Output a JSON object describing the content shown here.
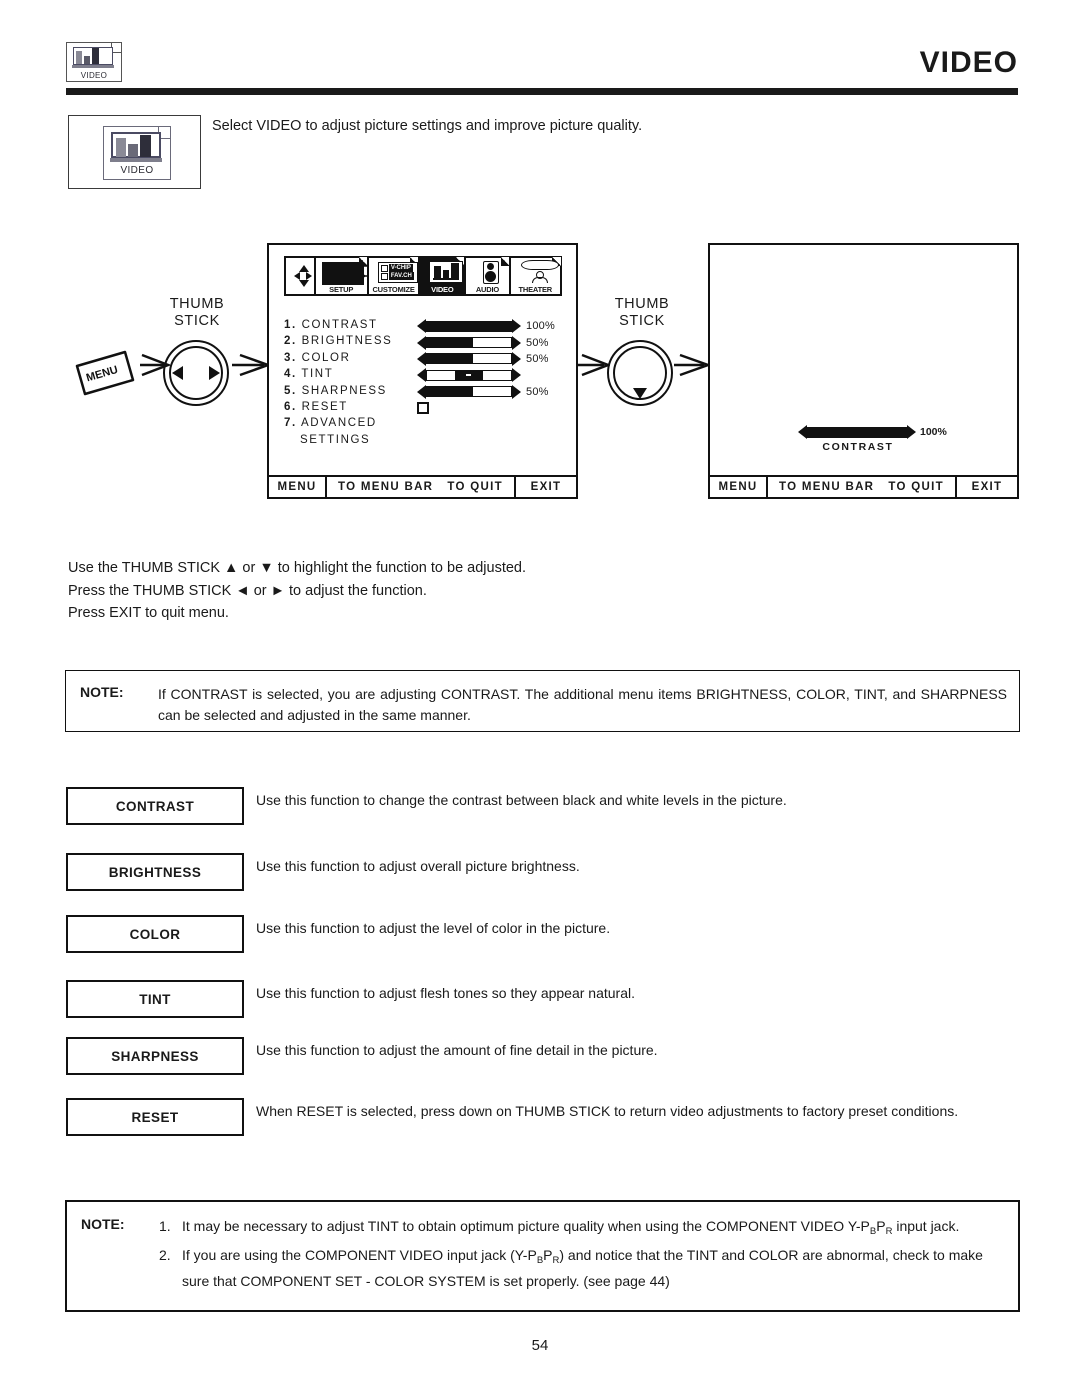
{
  "header": {
    "title": "VIDEO",
    "icon_label": "VIDEO"
  },
  "intro": {
    "icon_label": "VIDEO",
    "text": "Select VIDEO to adjust picture settings and improve picture quality."
  },
  "diagram": {
    "menu_key_label": "MENU",
    "thumb_stick_label_left": "THUMB\nSTICK",
    "thumb_stick_line1": "THUMB",
    "thumb_stick_line2": "STICK",
    "osd_tabs": [
      {
        "label": "",
        "name": "nav-pad"
      },
      {
        "label": "SETUP"
      },
      {
        "label": "CUSTOMIZE"
      },
      {
        "label": "VIDEO",
        "selected": true
      },
      {
        "label": "AUDIO"
      },
      {
        "label": "THEATER"
      }
    ],
    "customize_icon_text": [
      "V-CHIP",
      "FAV.CH"
    ],
    "menu_items": [
      {
        "num": "1.",
        "label": "CONTRAST",
        "fill": 100,
        "pct": "100%",
        "type": "bar"
      },
      {
        "num": "2.",
        "label": "BRIGHTNESS",
        "fill": 55,
        "pct": "50%",
        "type": "bar"
      },
      {
        "num": "3.",
        "label": "COLOR",
        "fill": 55,
        "pct": "50%",
        "type": "bar"
      },
      {
        "num": "4.",
        "label": "TINT",
        "fill": 0,
        "pct": "",
        "type": "center"
      },
      {
        "num": "5.",
        "label": "SHARPNESS",
        "fill": 55,
        "pct": "50%",
        "type": "bar"
      },
      {
        "num": "6.",
        "label": "RESET",
        "type": "checkbox"
      },
      {
        "num": "7.",
        "label": "ADVANCED",
        "type": "none"
      },
      {
        "num": "",
        "label": "SETTINGS",
        "type": "none"
      }
    ],
    "osd_footer": {
      "menu": "MENU",
      "to_menu_bar": "TO MENU BAR",
      "to_quit": "TO QUIT",
      "exit": "EXIT"
    },
    "osd2": {
      "bar_pct": "100%",
      "bar_label": "CONTRAST",
      "bar_fill": 100
    }
  },
  "instructions": [
    "Use the THUMB STICK ▲ or ▼ to highlight the function to be adjusted.",
    "Press the THUMB STICK ◄ or ► to adjust the function.",
    "Press EXIT to quit menu."
  ],
  "note1": {
    "label": "NOTE:",
    "text": "If CONTRAST is selected, you are adjusting CONTRAST.  The additional menu items BRIGHTNESS, COLOR, TINT, and SHARPNESS can be selected and adjusted in the same manner."
  },
  "functions": [
    {
      "name": "CONTRAST",
      "desc": "Use this function to change the contrast between black and white levels in the picture."
    },
    {
      "name": "BRIGHTNESS",
      "desc": "Use this function to adjust overall picture brightness."
    },
    {
      "name": "COLOR",
      "desc": "Use this function to adjust the level of color in the picture."
    },
    {
      "name": "TINT",
      "desc": "Use this function to adjust flesh tones so they appear natural."
    },
    {
      "name": "SHARPNESS",
      "desc": "Use this function to adjust the amount of fine detail in the picture."
    },
    {
      "name": "RESET",
      "desc": "When RESET is selected, press down on THUMB STICK to return video adjustments to factory preset conditions."
    }
  ],
  "note2": {
    "label": "NOTE:",
    "items": [
      {
        "n": "1.",
        "pre": "It may be necessary to adjust TINT to obtain optimum picture quality when using the COMPONENT VIDEO Y-P",
        "sub1": "B",
        "mid": "P",
        "sub2": "R",
        "post": " input jack."
      },
      {
        "n": "2.",
        "pre": "If you are using the COMPONENT VIDEO input jack (Y-P",
        "sub1": "B",
        "mid": "P",
        "sub2": "R",
        "post": ") and notice that the TINT and COLOR are abnormal, check to make sure that COMPONENT SET - COLOR SYSTEM is set properly. (see page 44)"
      }
    ]
  },
  "page_number": "54"
}
